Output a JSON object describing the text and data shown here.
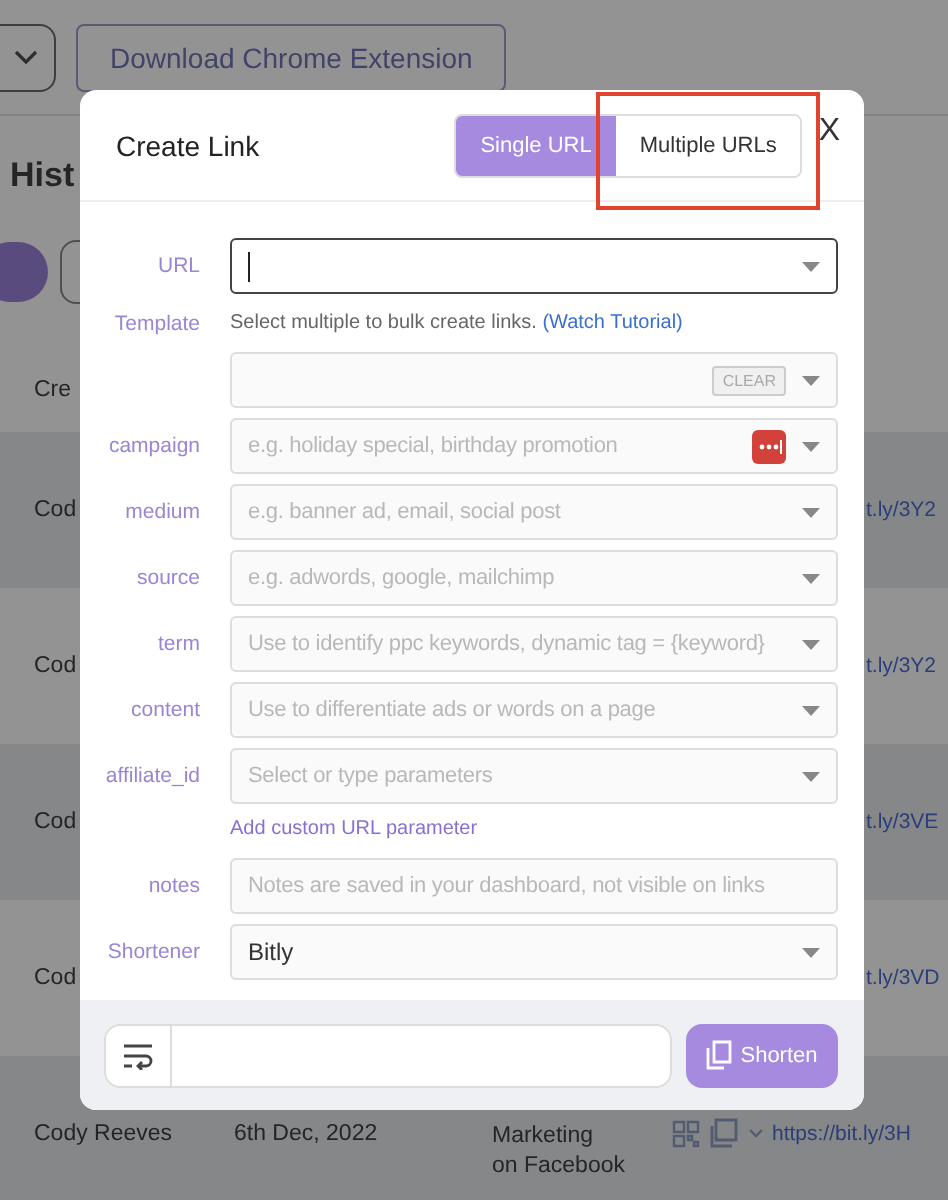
{
  "top_bar": {
    "download_button": "Download Chrome Extension"
  },
  "heading": "Hist",
  "table": {
    "header": "Cre",
    "rows": [
      {
        "name": "Cod",
        "link": "t.ly/3Y2"
      },
      {
        "name": "Cod",
        "link": "t.ly/3Y2"
      },
      {
        "name": "Cod",
        "link": "t.ly/3VE"
      },
      {
        "name": "Cod",
        "link": "t.ly/3VD"
      },
      {
        "name": "Cody Reeves",
        "date": "6th Dec, 2022",
        "campaign": [
          "Marketing",
          "on Facebook"
        ],
        "link": "https://bit.ly/3H"
      }
    ]
  },
  "dialog": {
    "title": "Create Link",
    "tabs": [
      {
        "label": "Single URL",
        "selected": true
      },
      {
        "label": "Multiple URLs",
        "selected": false
      }
    ],
    "close": "X",
    "fields": [
      {
        "kind": "select",
        "label": "URL",
        "focused": true
      },
      {
        "kind": "template",
        "label": "Template",
        "hint": "Select multiple to bulk create links. ",
        "link": "(Watch Tutorial)",
        "clear": "CLEAR"
      },
      {
        "kind": "select",
        "label": "campaign",
        "placeholder": "e.g. holiday special, birthday promotion",
        "extension_icon": true
      },
      {
        "kind": "select",
        "label": "medium",
        "placeholder": "e.g. banner ad, email, social post"
      },
      {
        "kind": "select",
        "label": "source",
        "placeholder": "e.g. adwords, google, mailchimp"
      },
      {
        "kind": "select",
        "label": "term",
        "placeholder": "Use to identify ppc keywords, dynamic tag = {keyword}"
      },
      {
        "kind": "select",
        "label": "content",
        "placeholder": "Use to differentiate ads or words on a page"
      },
      {
        "kind": "select",
        "label": "affiliate_id",
        "placeholder": "Select or type parameters"
      },
      {
        "kind": "link",
        "text": "Add custom URL parameter"
      },
      {
        "kind": "text",
        "label": "notes",
        "placeholder": "Notes are saved in your dashboard, not visible on links"
      },
      {
        "kind": "select",
        "label": "Shortener",
        "value": "Bitly"
      }
    ],
    "shorten_button": "Shorten"
  }
}
